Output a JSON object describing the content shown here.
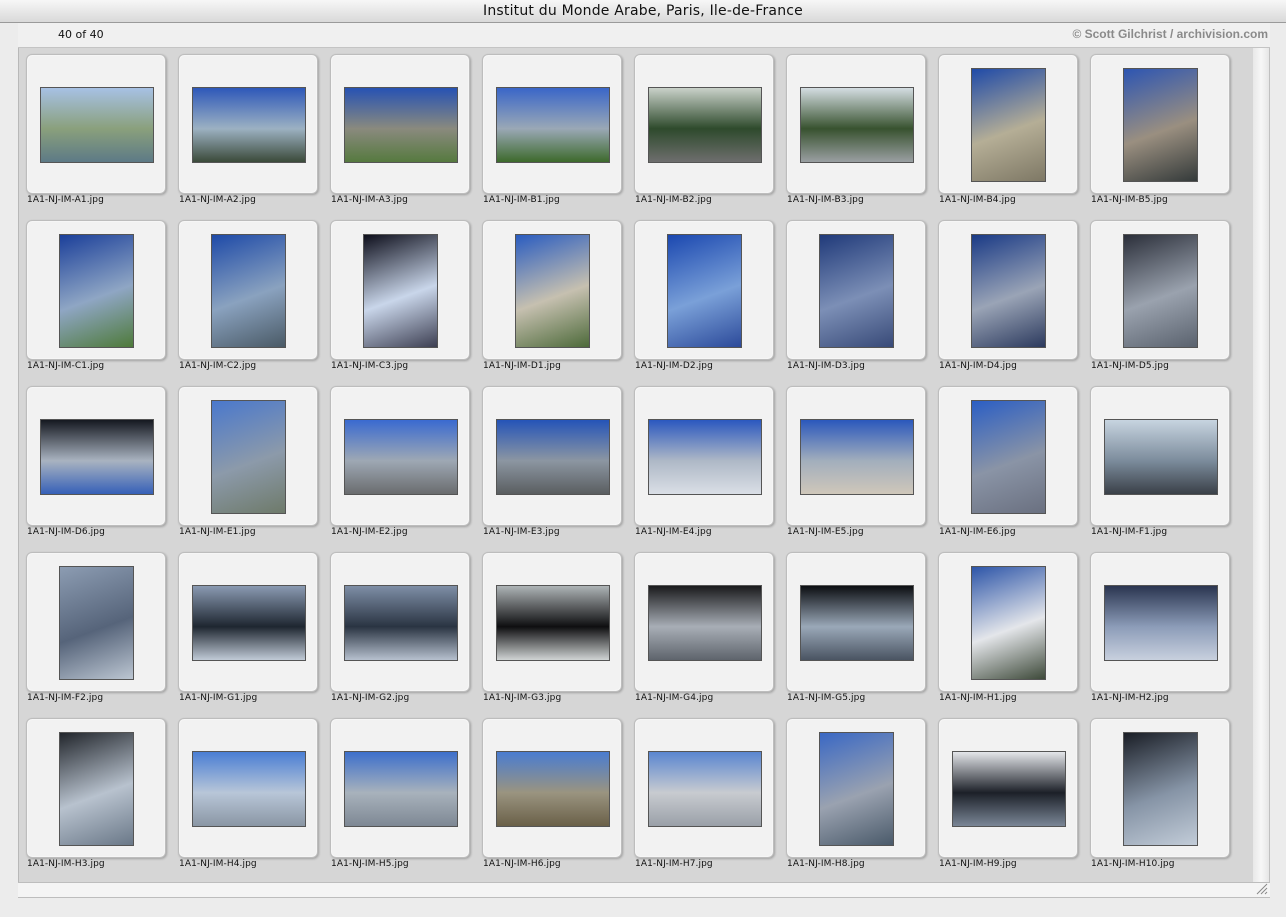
{
  "window": {
    "title": "Institut du Monde Arabe, Paris, Ile-de-France",
    "count_text": "40 of 40",
    "credit": "© Scott Gilchrist / archivision.com"
  },
  "images": [
    {
      "file": "1A1-NJ-IM-A1.jpg",
      "orientation": "land",
      "colors": [
        "#a7c1e4",
        "#8aa07c",
        "#5d7a86"
      ]
    },
    {
      "file": "1A1-NJ-IM-A2.jpg",
      "orientation": "land",
      "colors": [
        "#2e58b9",
        "#9cb1c2",
        "#3b4a3a"
      ]
    },
    {
      "file": "1A1-NJ-IM-A3.jpg",
      "orientation": "land",
      "colors": [
        "#2752b3",
        "#8a8a7e",
        "#567a3f"
      ]
    },
    {
      "file": "1A1-NJ-IM-B1.jpg",
      "orientation": "land",
      "colors": [
        "#3a66c8",
        "#9aa8b6",
        "#3d6a2c"
      ]
    },
    {
      "file": "1A1-NJ-IM-B2.jpg",
      "orientation": "land",
      "colors": [
        "#c9d1c9",
        "#2e4a2c",
        "#6e6e6e"
      ]
    },
    {
      "file": "1A1-NJ-IM-B3.jpg",
      "orientation": "land",
      "colors": [
        "#d4dde2",
        "#38522f",
        "#9a9fa2"
      ]
    },
    {
      "file": "1A1-NJ-IM-B4.jpg",
      "orientation": "port",
      "colors": [
        "#1f4aa8",
        "#b5ae96",
        "#7e7865"
      ]
    },
    {
      "file": "1A1-NJ-IM-B5.jpg",
      "orientation": "port",
      "colors": [
        "#2d55b2",
        "#9a8f80",
        "#343a3a"
      ]
    },
    {
      "file": "1A1-NJ-IM-C1.jpg",
      "orientation": "port",
      "colors": [
        "#1b3f9a",
        "#8fa6c4",
        "#4e7a3a"
      ]
    },
    {
      "file": "1A1-NJ-IM-C2.jpg",
      "orientation": "port",
      "colors": [
        "#1e4aa8",
        "#8aa2bf",
        "#4a5a66"
      ]
    },
    {
      "file": "1A1-NJ-IM-C3.jpg",
      "orientation": "port",
      "colors": [
        "#0e0f1c",
        "#c9d6ea",
        "#3d3f52"
      ]
    },
    {
      "file": "1A1-NJ-IM-D1.jpg",
      "orientation": "port",
      "colors": [
        "#2a5cc0",
        "#c6c0b0",
        "#4d6a3a"
      ]
    },
    {
      "file": "1A1-NJ-IM-D2.jpg",
      "orientation": "port",
      "colors": [
        "#1b48b0",
        "#7aa0d8",
        "#2c4a9a"
      ]
    },
    {
      "file": "1A1-NJ-IM-D3.jpg",
      "orientation": "port",
      "colors": [
        "#203a7a",
        "#7c8fb6",
        "#384a78"
      ]
    },
    {
      "file": "1A1-NJ-IM-D4.jpg",
      "orientation": "port",
      "colors": [
        "#1a3a86",
        "#9aa4b6",
        "#2c3a5e"
      ]
    },
    {
      "file": "1A1-NJ-IM-D5.jpg",
      "orientation": "port",
      "colors": [
        "#2b2f3a",
        "#9aa2ae",
        "#5a626e"
      ]
    },
    {
      "file": "1A1-NJ-IM-D6.jpg",
      "orientation": "land",
      "colors": [
        "#151820",
        "#a9b3c0",
        "#3660b8"
      ]
    },
    {
      "file": "1A1-NJ-IM-E1.jpg",
      "orientation": "port",
      "colors": [
        "#4a78cc",
        "#8c9aaa",
        "#6e7a6a"
      ]
    },
    {
      "file": "1A1-NJ-IM-E2.jpg",
      "orientation": "land",
      "colors": [
        "#3a6ad0",
        "#9ea8b4",
        "#6a6c6e"
      ]
    },
    {
      "file": "1A1-NJ-IM-E3.jpg",
      "orientation": "land",
      "colors": [
        "#2554b8",
        "#8c96a2",
        "#5a5e60"
      ]
    },
    {
      "file": "1A1-NJ-IM-E4.jpg",
      "orientation": "land",
      "colors": [
        "#2b58bf",
        "#aeb8c6",
        "#dadfe6"
      ]
    },
    {
      "file": "1A1-NJ-IM-E5.jpg",
      "orientation": "land",
      "colors": [
        "#2b58bc",
        "#a2aebc",
        "#cfc7ba"
      ]
    },
    {
      "file": "1A1-NJ-IM-E6.jpg",
      "orientation": "port",
      "colors": [
        "#2b5ec4",
        "#8a94a6",
        "#6a7080"
      ]
    },
    {
      "file": "1A1-NJ-IM-F1.jpg",
      "orientation": "land",
      "colors": [
        "#c7d4e0",
        "#7c8c9c",
        "#3a4048"
      ]
    },
    {
      "file": "1A1-NJ-IM-F2.jpg",
      "orientation": "port",
      "colors": [
        "#8c9cb2",
        "#56647a",
        "#bcc6d2"
      ]
    },
    {
      "file": "1A1-NJ-IM-G1.jpg",
      "orientation": "land",
      "colors": [
        "#8a9ab2",
        "#1e2630",
        "#c0cad6"
      ]
    },
    {
      "file": "1A1-NJ-IM-G2.jpg",
      "orientation": "land",
      "colors": [
        "#7e8ea6",
        "#2a3442",
        "#b6c0ce"
      ]
    },
    {
      "file": "1A1-NJ-IM-G3.jpg",
      "orientation": "land",
      "colors": [
        "#aeb4b6",
        "#0e0e10",
        "#d0d4d4"
      ]
    },
    {
      "file": "1A1-NJ-IM-G4.jpg",
      "orientation": "land",
      "colors": [
        "#1a1a1c",
        "#a8aeb6",
        "#5e646c"
      ]
    },
    {
      "file": "1A1-NJ-IM-G5.jpg",
      "orientation": "land",
      "colors": [
        "#0c0e12",
        "#9aa8b8",
        "#4a5462"
      ]
    },
    {
      "file": "1A1-NJ-IM-H1.jpg",
      "orientation": "port",
      "colors": [
        "#2d55a8",
        "#e4e6ea",
        "#3e4a3a"
      ]
    },
    {
      "file": "1A1-NJ-IM-H2.jpg",
      "orientation": "land",
      "colors": [
        "#2a3550",
        "#8c9cb8",
        "#c8d0de"
      ]
    },
    {
      "file": "1A1-NJ-IM-H3.jpg",
      "orientation": "port",
      "colors": [
        "#22262c",
        "#b8c2ce",
        "#6a7888"
      ]
    },
    {
      "file": "1A1-NJ-IM-H4.jpg",
      "orientation": "land",
      "colors": [
        "#4a7ed4",
        "#b8c6d8",
        "#8a96a4"
      ]
    },
    {
      "file": "1A1-NJ-IM-H5.jpg",
      "orientation": "land",
      "colors": [
        "#3d6fcb",
        "#a8b2bc",
        "#7e8894"
      ]
    },
    {
      "file": "1A1-NJ-IM-H6.jpg",
      "orientation": "land",
      "colors": [
        "#4a7cd0",
        "#9a9480",
        "#6a6048"
      ]
    },
    {
      "file": "1A1-NJ-IM-H7.jpg",
      "orientation": "land",
      "colors": [
        "#5a86d0",
        "#c8cbd0",
        "#9aa0a8"
      ]
    },
    {
      "file": "1A1-NJ-IM-H8.jpg",
      "orientation": "port",
      "colors": [
        "#3a68c4",
        "#9aa2b0",
        "#4a5a6a"
      ]
    },
    {
      "file": "1A1-NJ-IM-H9.jpg",
      "orientation": "land",
      "colors": [
        "#e4e6ea",
        "#1c2028",
        "#7a8696"
      ]
    },
    {
      "file": "1A1-NJ-IM-H10.jpg",
      "orientation": "port",
      "colors": [
        "#1a1e26",
        "#8694a6",
        "#c2ccd8"
      ]
    }
  ]
}
